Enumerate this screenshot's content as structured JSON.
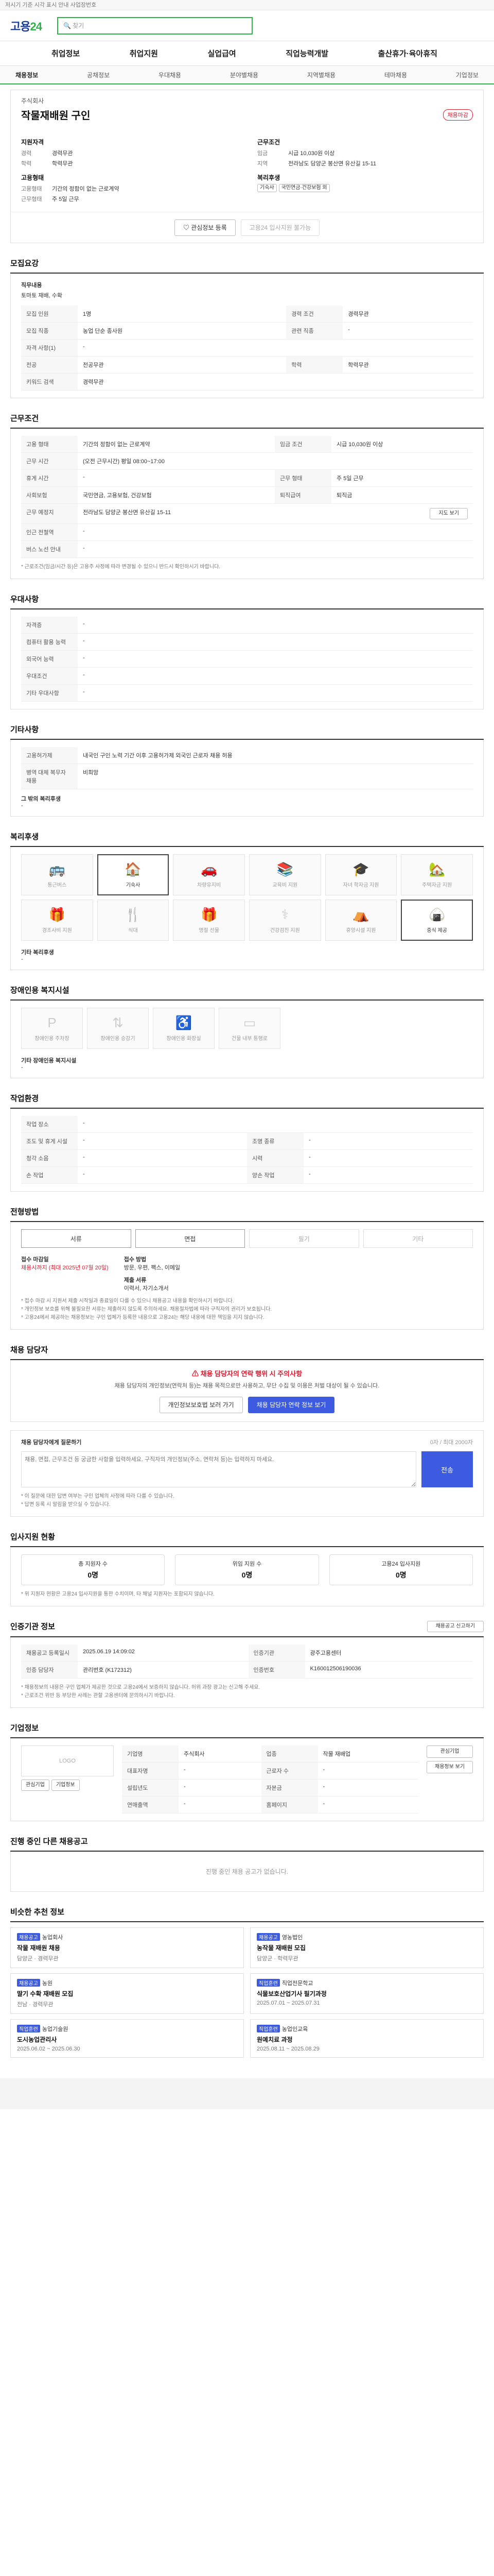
{
  "notice": "저시기 기준 시각 표시 안내 사업장번호",
  "header": {
    "logo_a": "고용",
    "logo_b": "24",
    "search": "찾기"
  },
  "mainnav": [
    "취업정보",
    "취업지원",
    "실업급여",
    "직업능력개발",
    "출산휴가·육아휴직"
  ],
  "subnav": [
    "채용정보",
    "공채정보",
    "우대채용",
    "분야별채용",
    "지역별채용",
    "테마채용",
    "기업정보"
  ],
  "job": {
    "company": "주식회사",
    "title": "작물재배원 구인",
    "status": "채용마감",
    "left_head": "지원자격",
    "left_rows": [
      {
        "k": "경력",
        "v": "경력무관"
      },
      {
        "k": "학력",
        "v": "학력무관"
      }
    ],
    "left_head2": "고용형태",
    "left_rows2": [
      {
        "k": "고용형태",
        "v": "기간의 정함이 없는 근로계약"
      },
      {
        "k": "근무형태",
        "v": "주 5일 근무"
      }
    ],
    "right_head": "근무조건",
    "right_rows": [
      {
        "k": "임금",
        "v": "시급 10,030원 이상"
      },
      {
        "k": "지역",
        "v": "전라남도 담양군 봉산면 유산길 15-11"
      }
    ],
    "right_head2": "복리후생",
    "right_pills": [
      "기숙사",
      "국민연금·건강보험 외"
    ]
  },
  "actions": {
    "save": "관심정보 등록",
    "apply": "고용24 입사지원 불가능"
  },
  "recruit": {
    "title": "모집요강",
    "duty_label": "직무내용",
    "duty": "토마토 재배, 수확",
    "rows": [
      [
        "모집 인원",
        "1명",
        "경력 조건",
        "경력무관"
      ],
      [
        "모집 직종",
        "농업 단순 종사원",
        "관련 직종",
        "-"
      ],
      [
        "자격 사항(1)",
        "-",
        "",
        ""
      ],
      [
        "전공",
        "전공무관",
        "학력",
        "학력무관"
      ],
      [
        "키워드 검색",
        "경력무관",
        "",
        ""
      ]
    ]
  },
  "work": {
    "title": "근무조건",
    "rows": [
      [
        "고용 형태",
        "기간의 정함이 없는 근로계약",
        "임금 조건",
        "시급 10,030원 이상"
      ],
      [
        "근무 시간",
        "(오전 근무시간) 평일 08:00~17:00",
        "",
        ""
      ],
      [
        "휴게 시간",
        "-",
        "근무 형태",
        "주 5일 근무"
      ],
      [
        "사회보험",
        "국민연금, 고용보험, 건강보험",
        "퇴직급여",
        "퇴직금"
      ],
      [
        "근무 예정지",
        "전라남도 담양군 봉산면 유산길 15-11",
        "",
        ""
      ],
      [
        "인근 전철역",
        "-",
        "",
        ""
      ],
      [
        "버스 노선 안내",
        "-",
        "",
        ""
      ]
    ],
    "note": "* 근로조건(임금/시간 등)은 고용주 사정에 따라 변경될 수 있으니 반드시 확인하시기 바랍니다.",
    "map_button": "지도 보기"
  },
  "pref": {
    "title": "우대사항",
    "rows": [
      [
        "자격증",
        "-"
      ],
      [
        "컴퓨터 활용 능력",
        "-"
      ],
      [
        "외국어 능력",
        "-"
      ],
      [
        "우대조건",
        "-"
      ],
      [
        "기타 우대사항",
        "-"
      ]
    ]
  },
  "etc": {
    "title": "기타사항",
    "rows": [
      [
        "고용허가제",
        "내국인 구인 노력 기간 이후 고용허가제 외국인 근로자 채용 허용"
      ],
      [
        "병역 대체 복무자 채용",
        "비희망"
      ]
    ],
    "attach": "그 밖의 복리후생",
    "attach_v": "-"
  },
  "welfare": {
    "title": "복리후생",
    "items": [
      "통근버스",
      "기숙사",
      "차량유지비",
      "교육비 지원",
      "자녀 학자금 지원",
      "주택자금 지원",
      "경조사비 지원",
      "식대",
      "명절 선물",
      "건강검진 지원",
      "휴양시설 지원",
      "중식 제공"
    ],
    "active": [
      1,
      11
    ],
    "extra_label": "기타 복리후생",
    "extra": "-"
  },
  "disab": {
    "title": "장애인용 복지시설",
    "items": [
      "장애인용 주차장",
      "장애인용 승강기",
      "장애인용 화장실",
      "건물 내부 통행로"
    ],
    "extra_label": "기타 장애인용 복지시설",
    "extra": "-"
  },
  "env": {
    "title": "작업환경",
    "rows": [
      [
        "작업 장소",
        "-",
        "",
        ""
      ],
      [
        "조도 및 휴게 시설",
        "-",
        "조명 종류",
        "-"
      ],
      [
        "청각 소음",
        "-",
        "시력",
        "-"
      ],
      [
        "손 작업",
        "-",
        "양손 작업",
        "-"
      ]
    ]
  },
  "process": {
    "title": "전형방법",
    "steps": [
      "서류",
      "면접",
      "필기",
      "기타"
    ],
    "on": [
      0,
      1
    ],
    "close_label": "접수 마감일",
    "close": "채용시까지 (최대 2025년 07월 20일)",
    "method_label": "접수 방법",
    "method": "방문, 우편, 팩스, 이메일",
    "doc_label": "제출 서류",
    "doc": "이력서, 자기소개서",
    "notes": [
      "* 접수 마감 시 지원서 제출 시작일과 종료일이 다를 수 있으니 채용공고 내용을 확인하시기 바랍니다.",
      "* 개인정보 보호를 위해 불필요한 서류는 제출하지 않도록 주의하세요. 채용절차법에 따라 구직자의 권리가 보호됩니다.",
      "* 고용24에서 제공하는 채용정보는 구인 업체가 등록한 내용으로 고용24는 해당 내용에 대한 책임을 지지 않습니다."
    ]
  },
  "manager": {
    "title": "채용 담당자",
    "warn": "채용 담당자의 연락 행위 시 주의사항",
    "desc": "채용 담당자의 개인정보(연락처 등)는 채용 목적으로만 사용하고, 무단 수집 및 이용은 처벌 대상이 될 수 있습니다.",
    "btn1": "개인정보보호법 보러 가기",
    "btn2": "채용 담당자 연락 정보 보기"
  },
  "qa": {
    "label": "채용 담당자에게 질문하기",
    "limit": "0자 / 최대 2000자",
    "placeholder": "채용, 면접, 근무조건 등 궁금한 사항을 입력하세요. 구직자의 개인정보(주소, 연락처 등)는 입력하지 마세요.",
    "submit": "전송",
    "notes": [
      "* 이 질문에 대한 답변 여부는 구인 업체의 사정에 따라 다를 수 있습니다.",
      "* 답변 등록 시 알림을 받으실 수 있습니다."
    ]
  },
  "applicants": {
    "title": "입사지원 현황",
    "items": [
      {
        "label": "총 지원자 수",
        "v": "0명"
      },
      {
        "label": "위임 지원 수",
        "v": "0명"
      },
      {
        "label": "고용24 입사지원",
        "v": "0명"
      }
    ],
    "note": "* 위 지원자 현황은 고용24 입사지원을 통한 수치이며, 타 채널 지원자는 포함되지 않습니다."
  },
  "info": {
    "title": "인증기관 정보",
    "rows": [
      [
        "채용공고 등록일시",
        "2025.06.19 14:09:02",
        "인증기관",
        "광주고용센터"
      ],
      [
        "인증 담당자",
        "관리번호 (K172312)",
        "인증번호",
        "K160012506190036"
      ]
    ],
    "btn": "채용공고 신고하기",
    "notes": [
      "* 채용정보의 내용은 구인 업체가 제공한 것으로 고용24에서 보증하지 않습니다. 허위 과장 광고는 신고해 주세요.",
      "* 근로조건 위반 등 부당한 사례는 관할 고용센터에 문의하시기 바랍니다."
    ]
  },
  "company": {
    "title": "기업정보",
    "logo": "LOGO",
    "rows": [
      [
        "기업명",
        "주식회사",
        "업종",
        "작물 재배업"
      ],
      [
        "대표자명",
        "-",
        "근로자 수",
        "-"
      ],
      [
        "설립년도",
        "-",
        "자본금",
        "-"
      ],
      [
        "연매출액",
        "-",
        "홈페이지",
        "-"
      ]
    ],
    "buttons": [
      "관심기업",
      "채용정보 보기"
    ],
    "sub_buttons": [
      "관심기업",
      "기업정보"
    ]
  },
  "others": {
    "title": "진행 중인 다른 채용공고",
    "empty": "진행 중인 채용 공고가 없습니다."
  },
  "similar": {
    "title": "비슷한 추천 정보",
    "items": [
      {
        "tag": "채용공고",
        "co": "농업회사",
        "t": "작물 재배원 채용",
        "d": "담양군 · 경력무관"
      },
      {
        "tag": "채용공고",
        "co": "영농법인",
        "t": "농작물 재배원 모집",
        "d": "담양군 · 학력무관"
      },
      {
        "tag": "채용공고",
        "co": "농원",
        "t": "딸기 수확 재배원 모집",
        "d": "전남 · 경력무관"
      },
      {
        "tag": "직업훈련",
        "co": "직업전문학교",
        "t": "식물보호산업기사 필기과정",
        "d": "2025.07.01 ~ 2025.07.31"
      },
      {
        "tag": "직업훈련",
        "co": "농업기술원",
        "t": "도시농업관리사",
        "d": "2025.06.02 ~ 2025.06.30"
      },
      {
        "tag": "직업훈련",
        "co": "농업인교육",
        "t": "원예치료 과정",
        "d": "2025.08.11 ~ 2025.08.29"
      }
    ]
  }
}
